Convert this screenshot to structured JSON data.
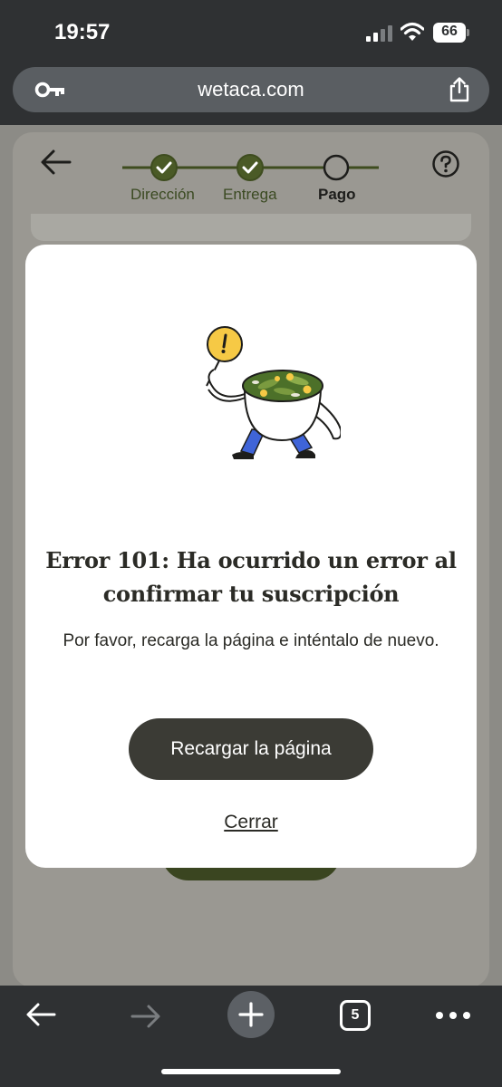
{
  "status_bar": {
    "time": "19:57",
    "battery_level": "66",
    "icons": [
      "cellular-signal-icon",
      "wifi-icon",
      "battery-icon"
    ]
  },
  "browser": {
    "url": "wetaca.com",
    "icons": [
      "key-icon",
      "share-icon"
    ]
  },
  "checkout": {
    "steps": [
      {
        "label": "Dirección",
        "state": "done"
      },
      {
        "label": "Entrega",
        "state": "done"
      },
      {
        "label": "Pago",
        "state": "current"
      }
    ],
    "icons": [
      "back-arrow-icon",
      "help-icon"
    ],
    "accent_color": "#4a5a26"
  },
  "modal": {
    "title": "Error 101: Ha ocurrido un error al confirmar tu suscripción",
    "message": "Por favor, recarga la página e inténtalo de nuevo.",
    "reload_button": "Recargar la página",
    "close_link": "Cerrar",
    "illustration_icon": "walking-salad-bowl-warning-illustration"
  },
  "toolbar": {
    "tabs_count": "5",
    "icons": [
      "back-icon",
      "forward-icon",
      "new-tab-icon",
      "tabs-icon",
      "more-icon"
    ]
  }
}
